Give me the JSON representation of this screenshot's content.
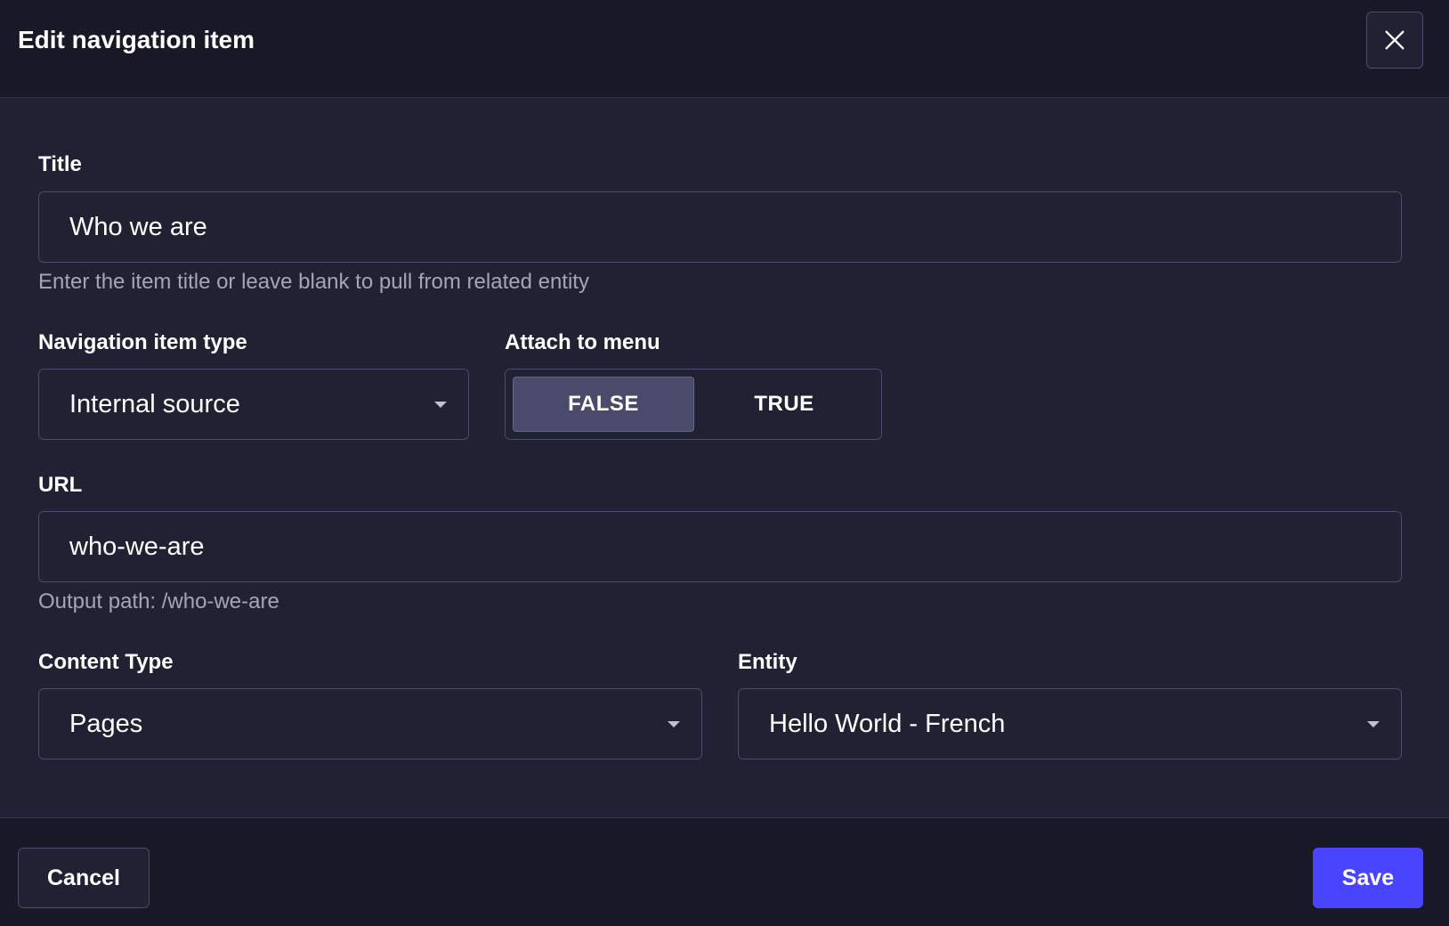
{
  "header": {
    "title": "Edit navigation item",
    "close_icon": "close-icon"
  },
  "form": {
    "title": {
      "label": "Title",
      "value": "Who we are",
      "hint": "Enter the item title or leave blank to pull from related entity"
    },
    "nav_type": {
      "label": "Navigation item type",
      "value": "Internal source"
    },
    "attach_menu": {
      "label": "Attach to menu",
      "options": [
        "FALSE",
        "TRUE"
      ],
      "selected": "FALSE"
    },
    "url": {
      "label": "URL",
      "value": "who-we-are",
      "hint": "Output path: /who-we-are"
    },
    "content_type": {
      "label": "Content Type",
      "value": "Pages"
    },
    "entity": {
      "label": "Entity",
      "value": "Hello World - French"
    }
  },
  "footer": {
    "cancel_label": "Cancel",
    "save_label": "Save"
  },
  "colors": {
    "background": "#212134",
    "header_bg": "#181826",
    "border": "#4a4a6a",
    "primary": "#4945ff",
    "hint_text": "#a5a5ba"
  }
}
